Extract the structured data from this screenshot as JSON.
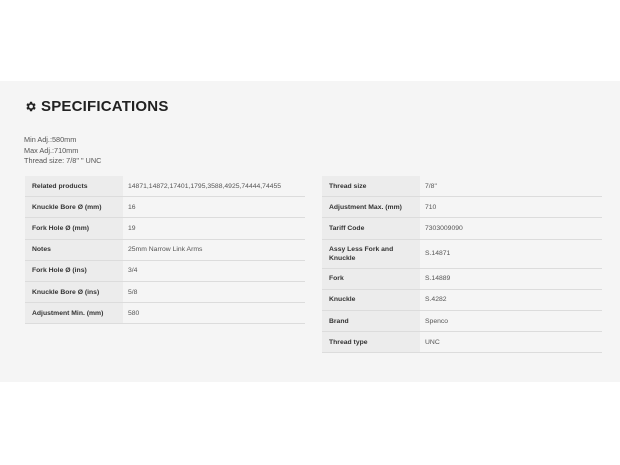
{
  "section": {
    "icon": "gear-icon",
    "title": "SPECIFICATIONS"
  },
  "summary": {
    "min_adj": "Min Adj.:580mm",
    "max_adj": "Max Adj.:710mm",
    "thread_size": "Thread size: 7/8\" \" UNC"
  },
  "left_table": [
    {
      "label": "Related products",
      "value": "14871,14872,17401,1795,3588,4925,74444,74455"
    },
    {
      "label": "Knuckle Bore Ø (mm)",
      "value": "16"
    },
    {
      "label": "Fork Hole Ø (mm)",
      "value": "19"
    },
    {
      "label": "Notes",
      "value": "25mm Narrow Link Arms"
    },
    {
      "label": "Fork Hole Ø (ins)",
      "value": "3/4"
    },
    {
      "label": "Knuckle Bore Ø (ins)",
      "value": "5/8"
    },
    {
      "label": "Adjustment Min. (mm)",
      "value": "580"
    }
  ],
  "right_table": [
    {
      "label": "Thread size",
      "value": "7/8\""
    },
    {
      "label": "Adjustment Max. (mm)",
      "value": "710"
    },
    {
      "label": "Tariff Code",
      "value": "7303009090"
    },
    {
      "label": "Assy Less Fork and Knuckle",
      "value": "S.14871"
    },
    {
      "label": "Fork",
      "value": "S.14889"
    },
    {
      "label": "Knuckle",
      "value": "S.4282"
    },
    {
      "label": "Brand",
      "value": "Spenco"
    },
    {
      "label": "Thread type",
      "value": "UNC"
    }
  ]
}
